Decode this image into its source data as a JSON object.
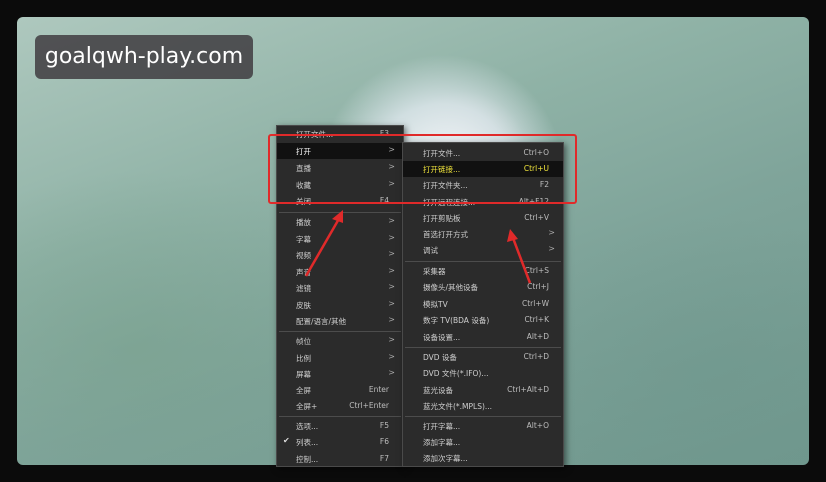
{
  "watermark": "goalqwh-play.com",
  "menu_main": [
    {
      "label": "打开文件...",
      "shortcut": "F3",
      "arrow": ""
    },
    {
      "label": "打开",
      "shortcut": "",
      "arrow": ">"
    },
    {
      "label": "直播",
      "shortcut": "",
      "arrow": ">"
    },
    {
      "label": "收藏",
      "shortcut": "",
      "arrow": ">"
    },
    {
      "label": "关闭",
      "shortcut": "F4",
      "arrow": ""
    },
    {
      "label": "播放",
      "shortcut": "",
      "arrow": ">"
    },
    {
      "label": "字幕",
      "shortcut": "",
      "arrow": ">"
    },
    {
      "label": "视频",
      "shortcut": "",
      "arrow": ">"
    },
    {
      "label": "声音",
      "shortcut": "",
      "arrow": ">"
    },
    {
      "label": "滤镜",
      "shortcut": "",
      "arrow": ">"
    },
    {
      "label": "皮肤",
      "shortcut": "",
      "arrow": ">"
    },
    {
      "label": "配置/语言/其他",
      "shortcut": "",
      "arrow": ">"
    },
    {
      "label": "帧位",
      "shortcut": "",
      "arrow": ">"
    },
    {
      "label": "比例",
      "shortcut": "",
      "arrow": ">"
    },
    {
      "label": "屏幕",
      "shortcut": "",
      "arrow": ">"
    },
    {
      "label": "全屏",
      "shortcut": "Enter",
      "arrow": ""
    },
    {
      "label": "全屏+",
      "shortcut": "Ctrl+Enter",
      "arrow": ""
    },
    {
      "label": "选项...",
      "shortcut": "F5",
      "arrow": ""
    },
    {
      "label": "列表...",
      "shortcut": "F6",
      "arrow": "",
      "checked": "✔"
    },
    {
      "label": "控制...",
      "shortcut": "F7",
      "arrow": ""
    }
  ],
  "menu_sub": [
    {
      "label": "打开文件...",
      "shortcut": "Ctrl+O",
      "arrow": ""
    },
    {
      "label": "打开链接...",
      "shortcut": "Ctrl+U",
      "arrow": ""
    },
    {
      "label": "打开文件夹...",
      "shortcut": "F2",
      "arrow": ""
    },
    {
      "label": "打开远程连接...",
      "shortcut": "Alt+F12",
      "arrow": ""
    },
    {
      "label": "打开剪贴板",
      "shortcut": "Ctrl+V",
      "arrow": ""
    },
    {
      "label": "首选打开方式",
      "shortcut": "",
      "arrow": ">"
    },
    {
      "label": "调试",
      "shortcut": "",
      "arrow": ">"
    },
    {
      "label": "采集器",
      "shortcut": "Ctrl+S",
      "arrow": ""
    },
    {
      "label": "摄像头/其他设备",
      "shortcut": "Ctrl+J",
      "arrow": ""
    },
    {
      "label": "模拟TV",
      "shortcut": "Ctrl+W",
      "arrow": ""
    },
    {
      "label": "数字 TV(BDA 设备)",
      "shortcut": "Ctrl+K",
      "arrow": ""
    },
    {
      "label": "设备设置...",
      "shortcut": "Alt+D",
      "arrow": ""
    },
    {
      "label": "DVD 设备",
      "shortcut": "Ctrl+D",
      "arrow": ""
    },
    {
      "label": "DVD 文件(*.IFO)...",
      "shortcut": "",
      "arrow": ""
    },
    {
      "label": "蓝光设备",
      "shortcut": "Ctrl+Alt+D",
      "arrow": ""
    },
    {
      "label": "蓝光文件(*.MPLS)...",
      "shortcut": "",
      "arrow": ""
    },
    {
      "label": "打开字幕...",
      "shortcut": "Alt+O",
      "arrow": ""
    },
    {
      "label": "添加字幕...",
      "shortcut": "",
      "arrow": ""
    },
    {
      "label": "添加次字幕...",
      "shortcut": "",
      "arrow": ""
    }
  ]
}
